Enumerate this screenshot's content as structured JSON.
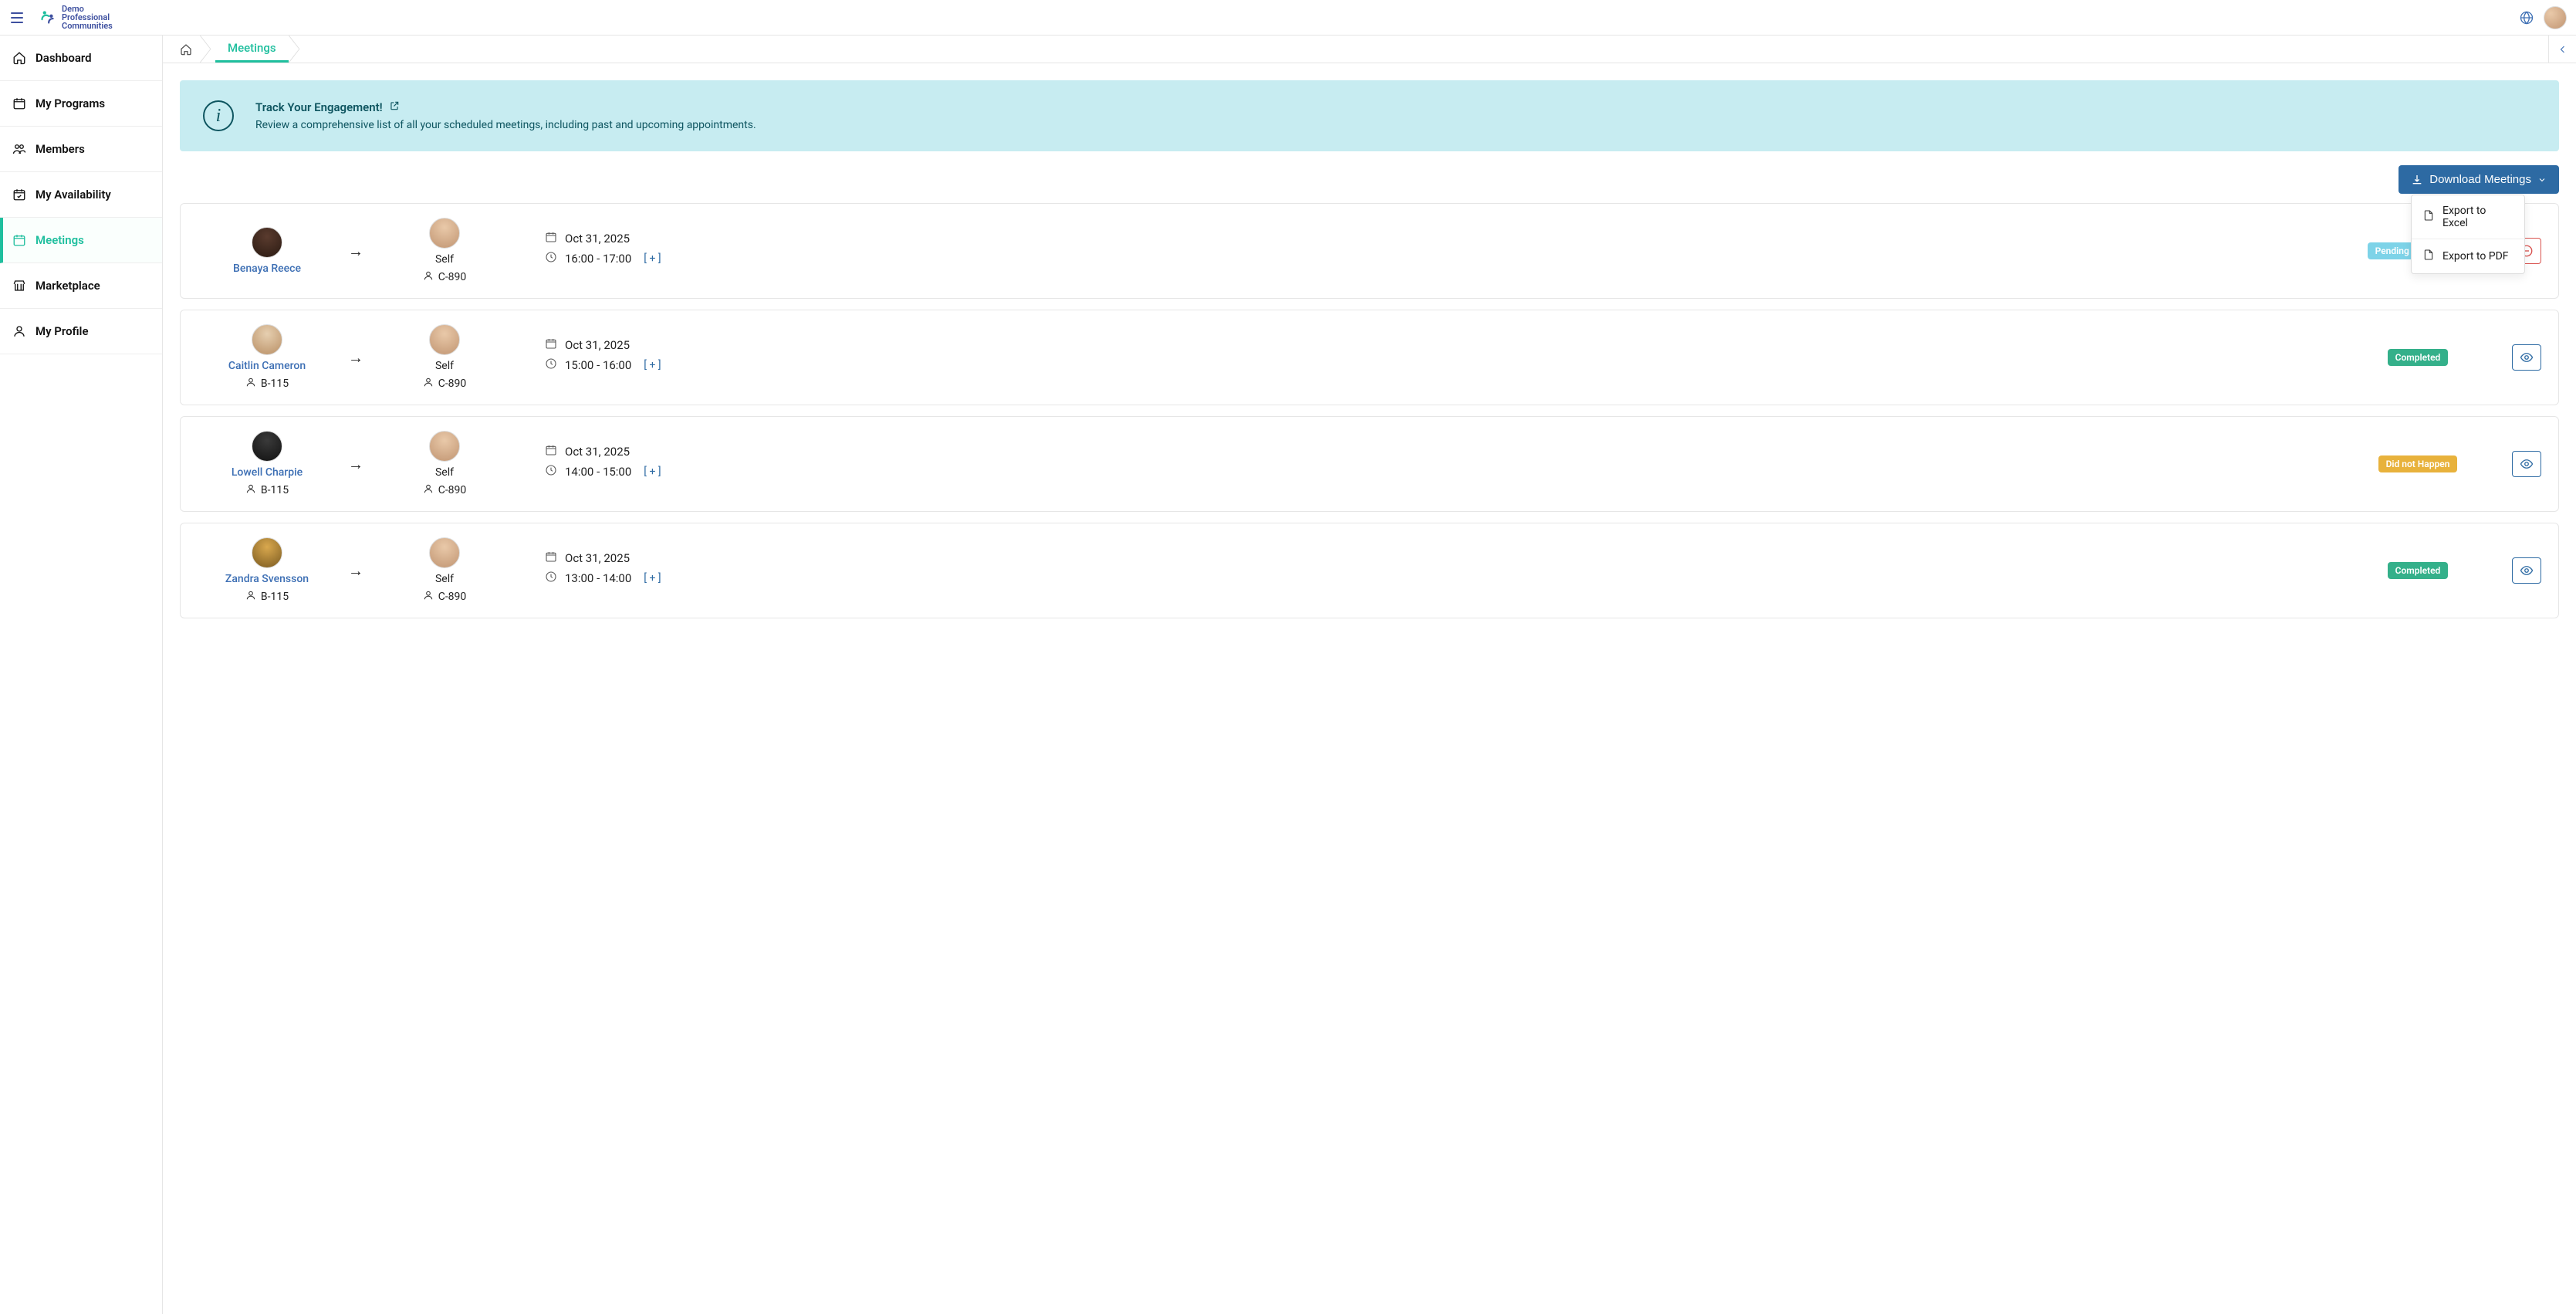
{
  "brand": {
    "line1": "Demo",
    "line2": "Professional",
    "line3": "Communities"
  },
  "sidebar": {
    "items": [
      {
        "label": "Dashboard"
      },
      {
        "label": "My Programs"
      },
      {
        "label": "Members"
      },
      {
        "label": "My Availability"
      },
      {
        "label": "Meetings"
      },
      {
        "label": "Marketplace"
      },
      {
        "label": "My Profile"
      }
    ]
  },
  "breadcrumb": {
    "current": "Meetings"
  },
  "banner": {
    "title": "Track Your Engagement!",
    "desc": "Review a comprehensive list of all your scheduled meetings, including past and upcoming appointments."
  },
  "download": {
    "button": "Download Meetings",
    "menu": {
      "excel": "Export to Excel",
      "pdf": "Export to PDF"
    }
  },
  "status_labels": {
    "pending": "Pending Acceptance",
    "completed": "Completed",
    "didnot": "Did not Happen"
  },
  "plus_expand": "[ + ]",
  "self_label": "Self",
  "meetings": [
    {
      "from_name": "Benaya Reece",
      "from_code": "",
      "to_code": "C-890",
      "date": "Oct 31, 2025",
      "time": "16:00 - 17:00",
      "status": "pending",
      "action": "cancel"
    },
    {
      "from_name": "Caitlin Cameron",
      "from_code": "B-115",
      "to_code": "C-890",
      "date": "Oct 31, 2025",
      "time": "15:00 - 16:00",
      "status": "completed",
      "action": "view"
    },
    {
      "from_name": "Lowell Charpie",
      "from_code": "B-115",
      "to_code": "C-890",
      "date": "Oct 31, 2025",
      "time": "14:00 - 15:00",
      "status": "didnot",
      "action": "view"
    },
    {
      "from_name": "Zandra Svensson",
      "from_code": "B-115",
      "to_code": "C-890",
      "date": "Oct 31, 2025",
      "time": "13:00 - 14:00",
      "status": "completed",
      "action": "view"
    }
  ]
}
